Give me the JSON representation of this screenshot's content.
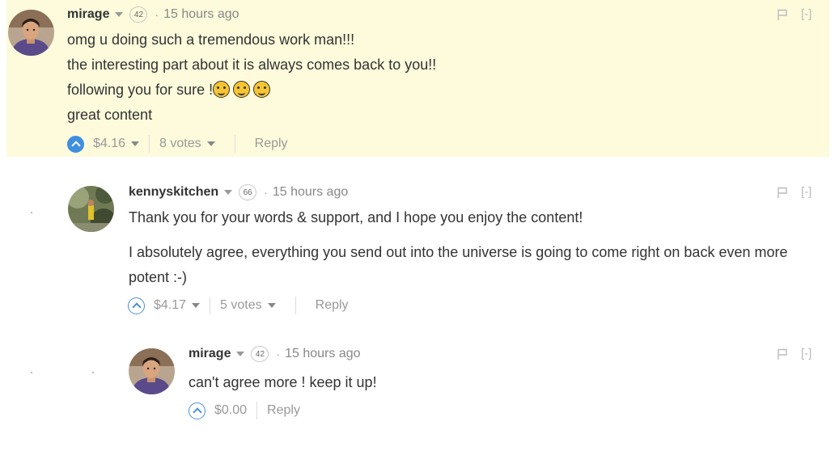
{
  "comments": [
    {
      "author": "mirage",
      "reputation": "42",
      "time": "15 hours ago",
      "lines": [
        "omg u doing such a tremendous work man!!!",
        "the interesting part about it is always comes back to you!!",
        "following you for sure !",
        "great content"
      ],
      "emoji_count": 3,
      "payout": "$4.16",
      "votes": "8 votes",
      "reply_label": "Reply",
      "collapse_label": "[-]",
      "upvoted": true
    },
    {
      "author": "kennyskitchen",
      "reputation": "66",
      "time": "15 hours ago",
      "para1": "Thank you for your words & support, and I hope you enjoy the content!",
      "para2": "I absolutely agree, everything you send out into the universe is going to come right on back even more potent :-)",
      "payout": "$4.17",
      "votes": "5 votes",
      "reply_label": "Reply",
      "collapse_label": "[-]",
      "upvoted": false
    },
    {
      "author": "mirage",
      "reputation": "42",
      "time": "15 hours ago",
      "text": "can't agree more ! keep it up!",
      "payout": "$0.00",
      "reply_label": "Reply",
      "collapse_label": "[-]",
      "upvoted": false
    }
  ],
  "separator": "·",
  "colors": {
    "highlight_bg": "#fdfbdc",
    "accent": "#3f8fe0",
    "muted": "#999999"
  }
}
